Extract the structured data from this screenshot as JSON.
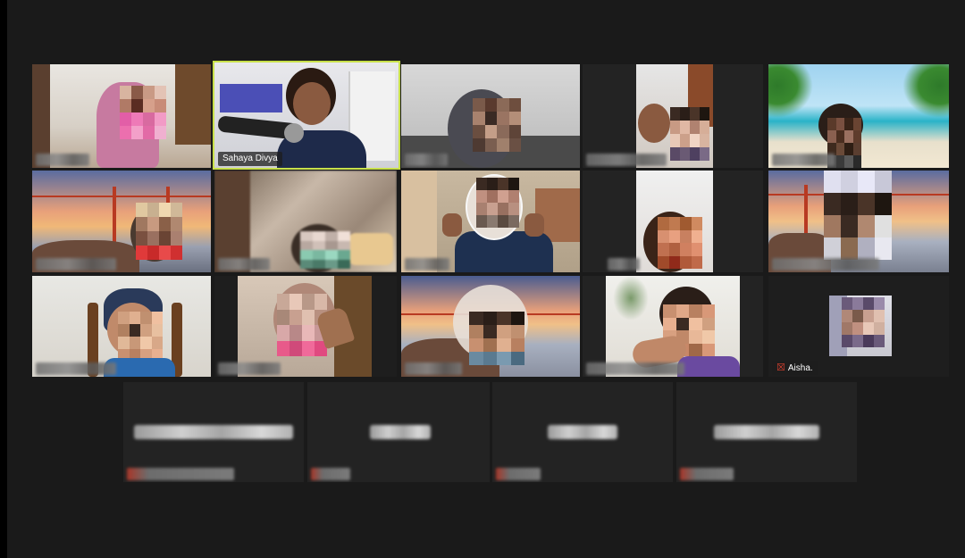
{
  "meeting": {
    "view": "gallery",
    "active_speaker": "Sahaya Divya"
  },
  "participants": [
    {
      "name": "",
      "video": true
    },
    {
      "name": "Sahaya Divya",
      "video": true,
      "active": true
    },
    {
      "name": "",
      "video": true
    },
    {
      "name": "",
      "video": true
    },
    {
      "name": "",
      "video": true
    },
    {
      "name": "",
      "video": true
    },
    {
      "name": "",
      "video": true
    },
    {
      "name": "",
      "video": true
    },
    {
      "name": "",
      "video": true
    },
    {
      "name": "",
      "video": true
    },
    {
      "name": "",
      "video": true
    },
    {
      "name": "",
      "video": true
    },
    {
      "name": "",
      "video": true
    },
    {
      "name": "",
      "video": true
    },
    {
      "name": "Aisha.",
      "video": true,
      "muted": true,
      "muted_icon": "mic-muted-icon"
    },
    {
      "name": "",
      "video": false
    },
    {
      "name": "",
      "video": false
    },
    {
      "name": "",
      "video": false
    },
    {
      "name": "",
      "video": false
    }
  ],
  "colors": {
    "background": "#1a1a1a",
    "active_border": "#c8e04a",
    "muted": "#e0412f"
  }
}
